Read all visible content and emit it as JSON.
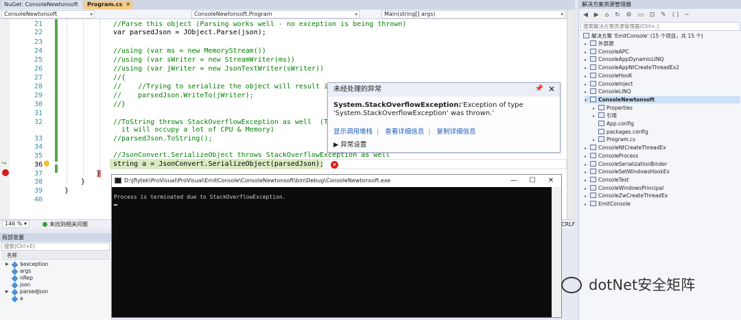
{
  "tabs": {
    "nuget": "NuGet: ConsoleNewtonsoft",
    "program": "Program.cs"
  },
  "nav": {
    "project": "ConsoleNewtonsoft",
    "class": "ConsoleNewtonsoft.Program",
    "member": "Main(string[] args)"
  },
  "editor": {
    "lines": [
      {
        "num": "21",
        "code": "//Parse this object (Parsing works well - no exception is being thrown)"
      },
      {
        "num": "22",
        "code": "var parsedJson = JObject.Parse(json);"
      },
      {
        "num": "23",
        "code": ""
      },
      {
        "num": "24",
        "code": "//using (var ms = new MemoryStream())"
      },
      {
        "num": "25",
        "code": "//using (var sWriter = new StreamWriter(ms))"
      },
      {
        "num": "26",
        "code": "//using (var jWriter = new JsonTextWriter(sWriter))"
      },
      {
        "num": "27",
        "code": "//{"
      },
      {
        "num": "28",
        "code": "//    //Trying to serialize the object will result i"
      },
      {
        "num": "29",
        "code": "//    parsedJson.WriteTo(jWriter);"
      },
      {
        "num": "30",
        "code": "//}"
      },
      {
        "num": "31",
        "code": ""
      },
      {
        "num": "32",
        "code": "//ToString throws StackOverflowException as well  (T"
      },
      {
        "num": "",
        "code": "  it will occupy a lot of CPU & Memory)"
      },
      {
        "num": "33",
        "code": "//parsedJson.ToString();"
      },
      {
        "num": "34",
        "code": ""
      },
      {
        "num": "35",
        "code": "//JsonConvert.SerializeObject throws StackOverflowException as well"
      },
      {
        "num": "36",
        "code": "string a = JsonConvert.SerializeObject(parsedJson);"
      },
      {
        "num": "37",
        "code": "}"
      },
      {
        "num": "38",
        "code": "}"
      },
      {
        "num": "39",
        "code": "}"
      },
      {
        "num": "40",
        "code": ""
      }
    ]
  },
  "status": {
    "zoom": "146 %",
    "issues": "未找到相关问题",
    "eol": "CRLF"
  },
  "popup": {
    "title": "未经处理的异常",
    "exception_type": "System.StackOverflowException:",
    "message_rest": "'Exception of type 'System.StackOverflowException' was thrown.'",
    "links": [
      "显示调用堆栈",
      "查看详细信息",
      "复制详细信息"
    ],
    "settings": "异常设置"
  },
  "console": {
    "title": "D:\\jflytek\\ProVisual\\ProVisual\\EmitConsole\\ConsoleNewtonsoft\\bin\\Debug\\ConsoleNewtonsoft.exe",
    "output": "Process is terminated due to StackOverflowException.",
    "minimize": "—",
    "maximize": "☐",
    "close": "✕"
  },
  "locals": {
    "title": "局部变量",
    "search_placeholder": "搜索(Ctrl+E)",
    "column_name": "名称",
    "rows": [
      {
        "name": "$exception",
        "expandable": true
      },
      {
        "name": "args",
        "expandable": false
      },
      {
        "name": "nRep",
        "expandable": false
      },
      {
        "name": "json",
        "expandable": false
      },
      {
        "name": "parsedJson",
        "expandable": true
      },
      {
        "name": "a",
        "expandable": false
      }
    ]
  },
  "solution": {
    "title": "解决方案资源管理器",
    "search_placeholder": "搜索解决方案资源管理器(Ctrl+;)",
    "root": "解决方案 'EmitConsole' (15 个项目，共 15 个)",
    "items": [
      {
        "label": "外部源",
        "indent": 1,
        "selected": false,
        "exp": "▸"
      },
      {
        "label": "ConsoleAPC",
        "indent": 1,
        "selected": false,
        "exp": "▸"
      },
      {
        "label": "ConsoleAppDynamicLINQ",
        "indent": 1,
        "selected": false,
        "exp": "▸"
      },
      {
        "label": "ConsoleAppNtCreateThreadEx2",
        "indent": 1,
        "selected": false,
        "exp": "▸"
      },
      {
        "label": "ConsoleHooK",
        "indent": 1,
        "selected": false,
        "exp": "▸"
      },
      {
        "label": "ConsoleInject",
        "indent": 1,
        "selected": false,
        "exp": "▸"
      },
      {
        "label": "ConsoleLINQ",
        "indent": 1,
        "selected": false,
        "exp": "▸"
      },
      {
        "label": "ConsoleNewtonsoft",
        "indent": 1,
        "selected": true,
        "exp": "▾"
      },
      {
        "label": "Properties",
        "indent": 2,
        "selected": false,
        "exp": "▸"
      },
      {
        "label": "引用",
        "indent": 2,
        "selected": false,
        "exp": "▸"
      },
      {
        "label": "App.config",
        "indent": 2,
        "selected": false,
        "exp": ""
      },
      {
        "label": "packages.config",
        "indent": 2,
        "selected": false,
        "exp": ""
      },
      {
        "label": "Program.cs",
        "indent": 2,
        "selected": false,
        "exp": "▸"
      },
      {
        "label": "ConsoleNtCreateThreadEx",
        "indent": 1,
        "selected": false,
        "exp": "▸"
      },
      {
        "label": "ConsoleProcess",
        "indent": 1,
        "selected": false,
        "exp": "▸"
      },
      {
        "label": "ConsoleSerializationBinder",
        "indent": 1,
        "selected": false,
        "exp": "▸"
      },
      {
        "label": "ConsoleSetWindowsHookEx",
        "indent": 1,
        "selected": false,
        "exp": "▸"
      },
      {
        "label": "ConsoleTest",
        "indent": 1,
        "selected": false,
        "exp": "▸"
      },
      {
        "label": "ConsoleWindowsPrincipal",
        "indent": 1,
        "selected": false,
        "exp": "▸"
      },
      {
        "label": "ConsoleZwCreateThreadEx",
        "indent": 1,
        "selected": false,
        "exp": "▸"
      },
      {
        "label": "EmitConsole",
        "indent": 1,
        "selected": false,
        "exp": "▸"
      }
    ]
  },
  "watermark": "dotNet安全矩阵"
}
